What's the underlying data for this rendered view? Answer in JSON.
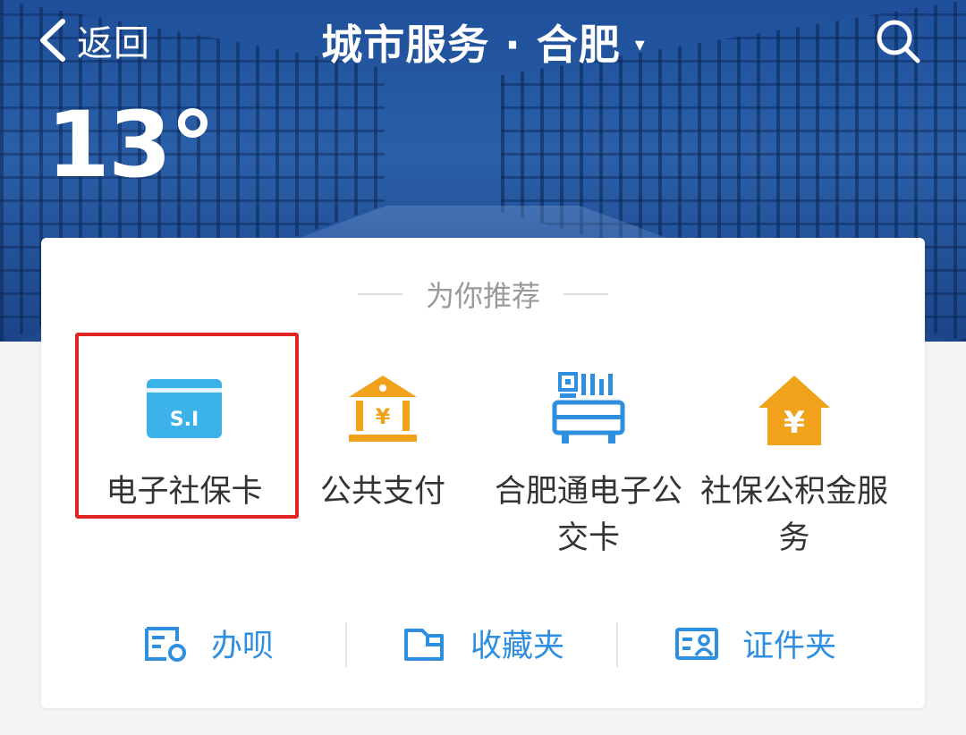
{
  "header": {
    "back_label": "返回",
    "title": "城市服务 · 合肥",
    "caret": "▾",
    "search_icon": "search-icon"
  },
  "weather": {
    "temperature": "13°"
  },
  "recommend": {
    "title": "为你推荐",
    "items": [
      {
        "label": "电子社保卡",
        "icon": "social-security-card-icon",
        "color": "#3bb2e8",
        "highlighted": true
      },
      {
        "label": "公共支付",
        "icon": "bank-yuan-icon",
        "color": "#f0a21a"
      },
      {
        "label": "合肥通电子公交卡",
        "icon": "bus-card-qr-icon",
        "color": "#2e8fe0"
      },
      {
        "label": "社保公积金服务",
        "icon": "house-yuan-icon",
        "color": "#f0a21a"
      }
    ]
  },
  "bottom_actions": [
    {
      "label": "办呗",
      "icon": "task-list-icon"
    },
    {
      "label": "收藏夹",
      "icon": "folder-icon"
    },
    {
      "label": "证件夹",
      "icon": "id-card-icon"
    }
  ],
  "colors": {
    "accent": "#2e8fe0",
    "highlight": "#e02424",
    "hero": "#1f4f9a"
  }
}
